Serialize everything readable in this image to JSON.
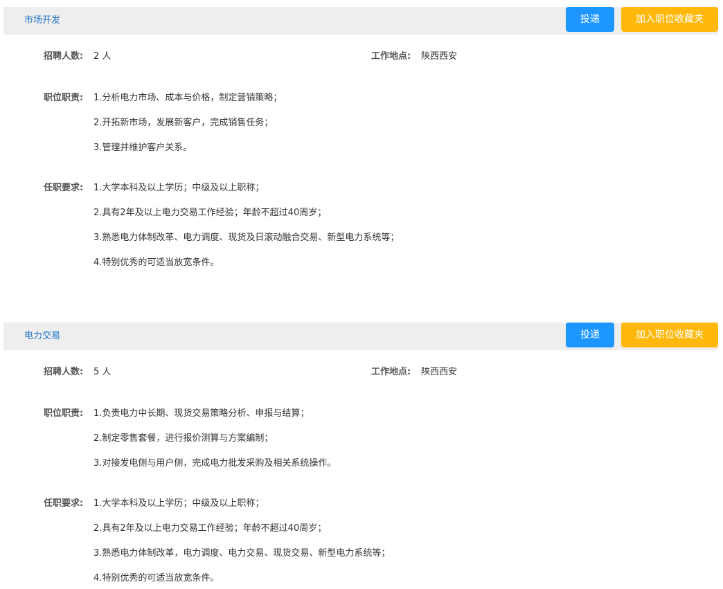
{
  "jobs": [
    {
      "title": "市场开发",
      "apply_label": "投递",
      "favorite_label": "加入职位收藏夹",
      "headcount_label": "招聘人数:",
      "headcount_value": "2 人",
      "location_label": "工作地点:",
      "location_value": "陕西西安",
      "duties_label": "职位职责:",
      "duties": [
        "1.分析电力市场、成本与价格，制定营销策略；",
        "2.开拓新市场，发展新客户，完成销售任务；",
        "3.管理并维护客户关系。"
      ],
      "requirements_label": "任职要求:",
      "requirements": [
        "1.大学本科及以上学历；中级及以上职称；",
        "2.具有2年及以上电力交易工作经验；年龄不超过40周岁；",
        "3.熟悉电力体制改革、电力调度、现货及日滚动融合交易、新型电力系统等；",
        "4.特别优秀的可适当放宽条件。"
      ]
    },
    {
      "title": "电力交易",
      "apply_label": "投递",
      "favorite_label": "加入职位收藏夹",
      "headcount_label": "招聘人数:",
      "headcount_value": "5 人",
      "location_label": "工作地点:",
      "location_value": "陕西西安",
      "duties_label": "职位职责:",
      "duties": [
        "1.负责电力中长期、现货交易策略分析、申报与结算；",
        "2.制定零售套餐，进行报价测算与方案编制；",
        "3.对接发电侧与用户侧，完成电力批发采购及相关系统操作。"
      ],
      "requirements_label": "任职要求:",
      "requirements": [
        "1.大学本科及以上学历；中级及以上职称；",
        "2.具有2年及以上电力交易工作经验；年龄不超过40周岁；",
        "3.熟悉电力体制改革，电力调度、电力交易、现货交易、新型电力系统等；",
        "4.特别优秀的可适当放宽条件。"
      ]
    }
  ]
}
